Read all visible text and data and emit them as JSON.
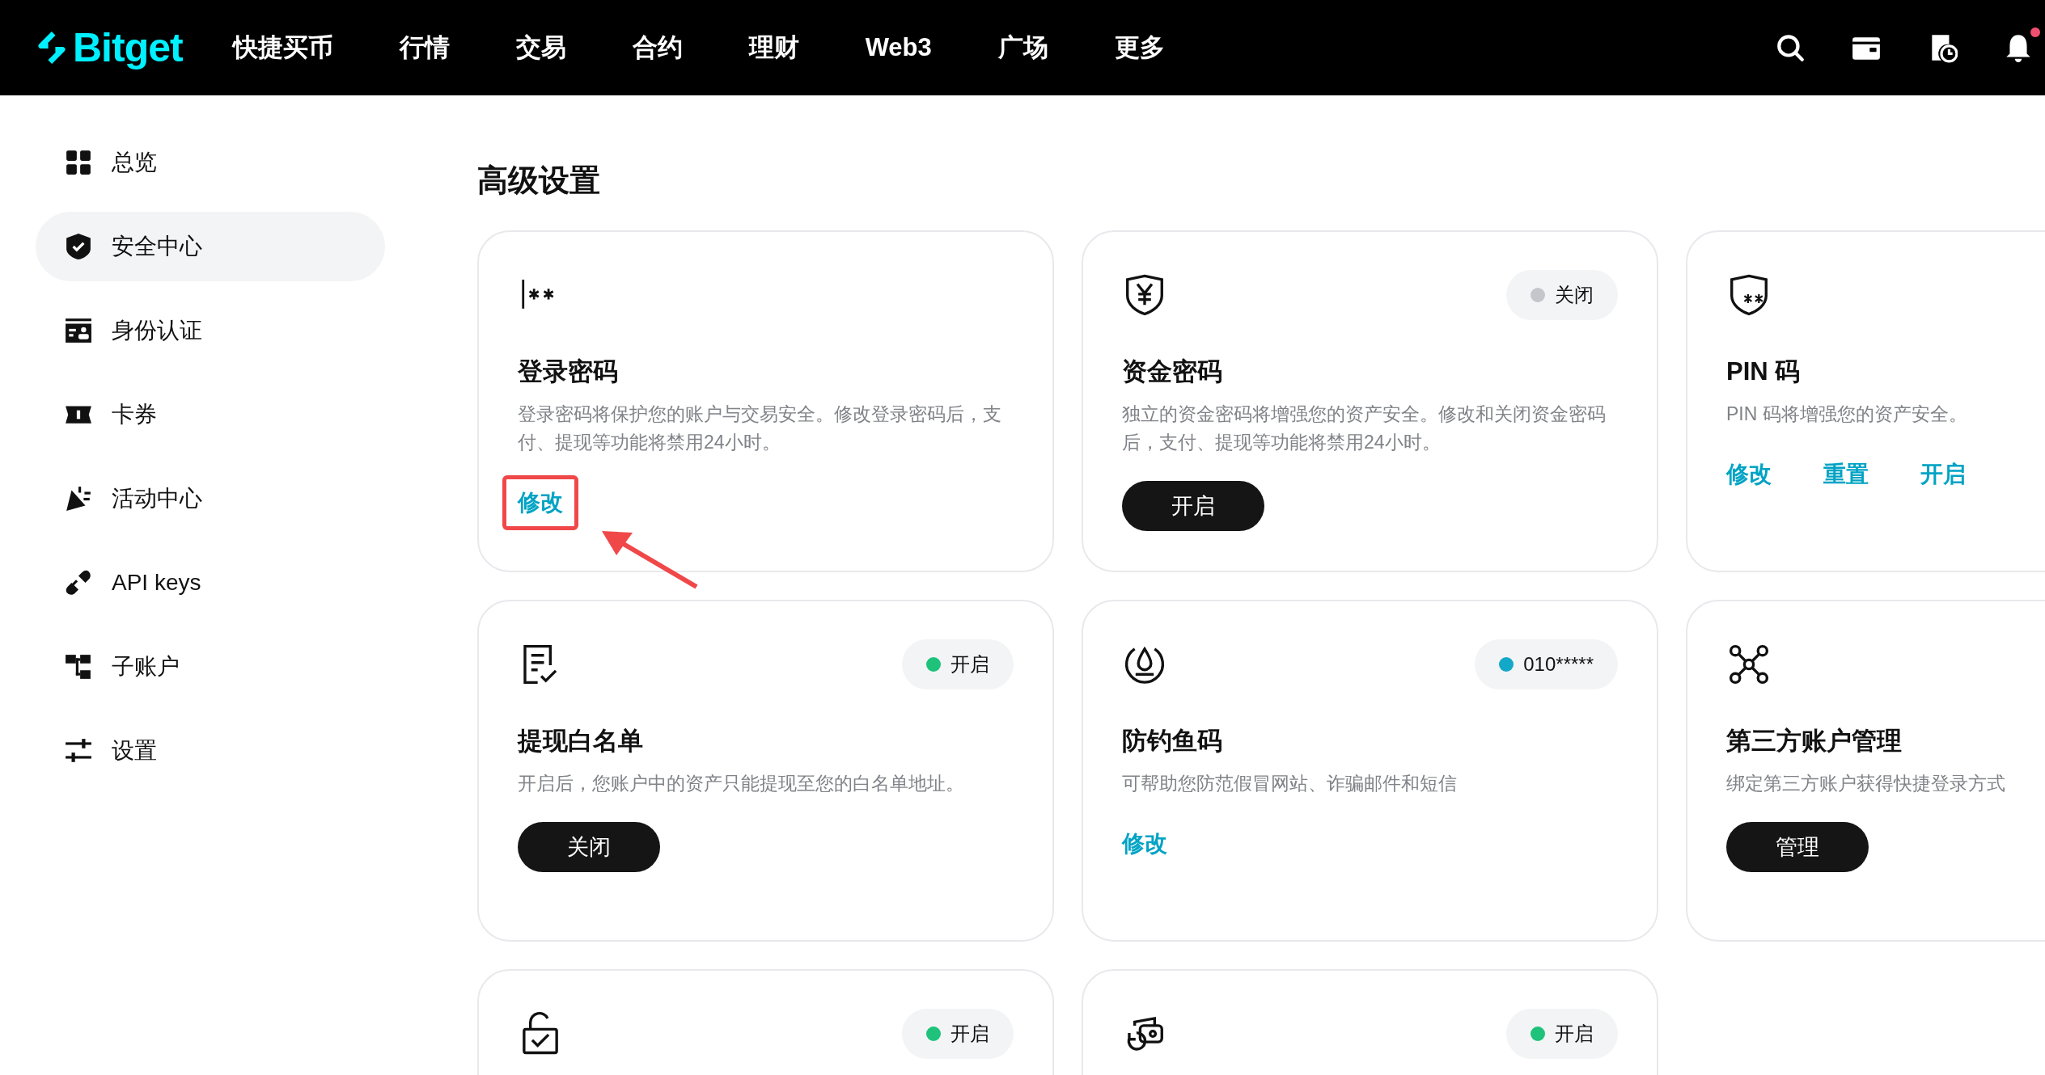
{
  "nav": {
    "logo": "Bitget",
    "items": [
      "快捷买币",
      "行情",
      "交易",
      "合约",
      "理财",
      "Web3",
      "广场",
      "更多"
    ],
    "notification_dot": true
  },
  "sidebar": {
    "items": [
      {
        "label": "总览",
        "selected": false
      },
      {
        "label": "安全中心",
        "selected": true
      },
      {
        "label": "身份认证",
        "selected": false
      },
      {
        "label": "卡券",
        "selected": false
      },
      {
        "label": "活动中心",
        "selected": false
      },
      {
        "label": "API keys",
        "selected": false
      },
      {
        "label": "子账户",
        "selected": false
      },
      {
        "label": "设置",
        "selected": false
      }
    ]
  },
  "page_title": "高级设置",
  "cards": [
    {
      "title": "登录密码",
      "description": "登录密码将保护您的账户与交易安全。修改登录密码后，支付、提现等功能将禁用24小时。",
      "actions": [
        {
          "kind": "link",
          "label": "修改",
          "highlighted": true
        }
      ]
    },
    {
      "title": "资金密码",
      "status": {
        "text": "关闭",
        "color": "#c4c6cc"
      },
      "description": "独立的资金密码将增强您的资产安全。修改和关闭资金密码后，支付、提现等功能将禁用24小时。",
      "actions": [
        {
          "kind": "button",
          "label": "开启",
          "highlighted": false
        }
      ]
    },
    {
      "title": "PIN 码",
      "description": "PIN 码将增强您的资产安全。",
      "actions": [
        {
          "kind": "link",
          "label": "修改",
          "highlighted": false
        },
        {
          "kind": "link",
          "label": "重置",
          "highlighted": false
        },
        {
          "kind": "link",
          "label": "开启",
          "highlighted": false
        }
      ]
    },
    {
      "title": "提现白名单",
      "status": {
        "text": "开启",
        "color": "#1ec27a"
      },
      "description": "开启后，您账户中的资产只能提现至您的白名单地址。",
      "actions": [
        {
          "kind": "button",
          "label": "关闭",
          "highlighted": false
        }
      ]
    },
    {
      "title": "防钓鱼码",
      "status": {
        "text": "010*****",
        "color": "#13a8c8"
      },
      "description": "可帮助您防范假冒网站、诈骗邮件和短信",
      "actions": [
        {
          "kind": "link",
          "label": "修改",
          "highlighted": false
        }
      ]
    },
    {
      "title": "第三方账户管理",
      "description": "绑定第三方账户获得快捷登录方式",
      "actions": [
        {
          "kind": "button",
          "label": "管理",
          "highlighted": false
        }
      ]
    },
    {
      "status": {
        "text": "开启",
        "color": "#1ec27a"
      }
    },
    {
      "status": {
        "text": "开启",
        "color": "#1ec27a"
      }
    }
  ]
}
